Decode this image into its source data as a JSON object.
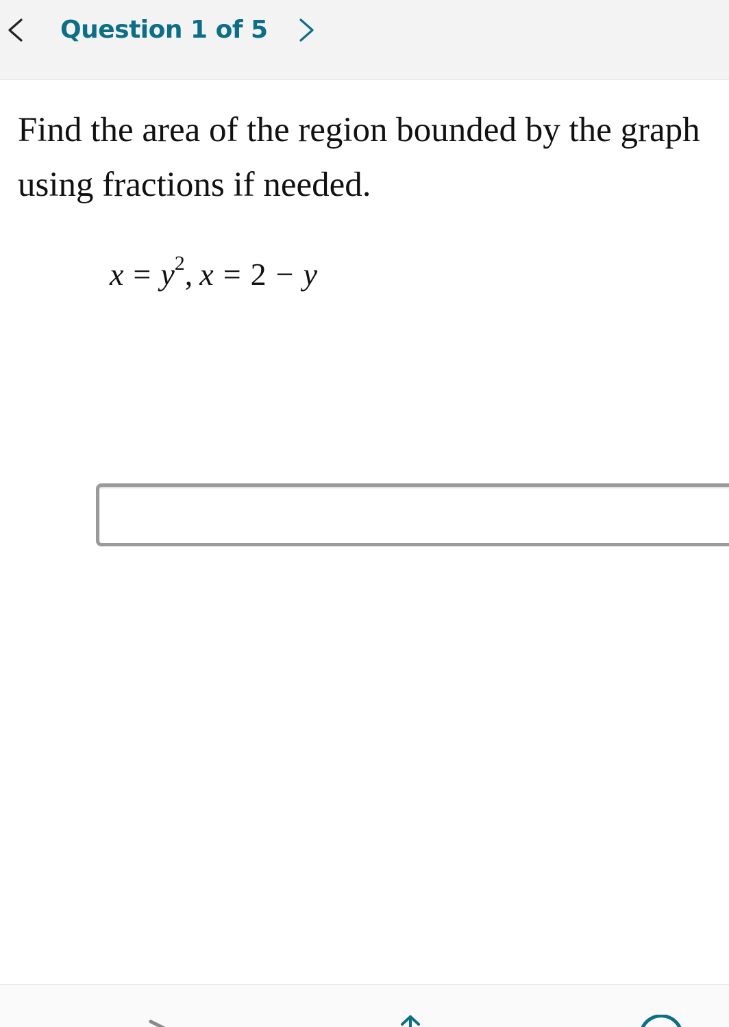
{
  "header": {
    "question_counter": "Question 1 of 5",
    "prev_icon": "chevron-left-icon",
    "next_icon": "chevron-right-icon"
  },
  "question": {
    "prompt_line1": "Find the area of the region bounded by the graph",
    "prompt_line2": "using fractions if needed.",
    "equation": {
      "lhs1": "x",
      "eq1": "=",
      "base": "y",
      "exp": "2",
      "sep": ",",
      "lhs2": "x",
      "eq2": "=",
      "const": "2",
      "minus": "−",
      "var": "y"
    }
  },
  "answer": {
    "value": ""
  },
  "colors": {
    "accent": "#0d6e87",
    "header_bg": "#f3f3f3",
    "text": "#111111",
    "input_border": "#9a9a9a"
  },
  "bottom_toolbar": {
    "icons": [
      "pen-icon",
      "upload-arrow-icon",
      "circle-icon"
    ]
  }
}
